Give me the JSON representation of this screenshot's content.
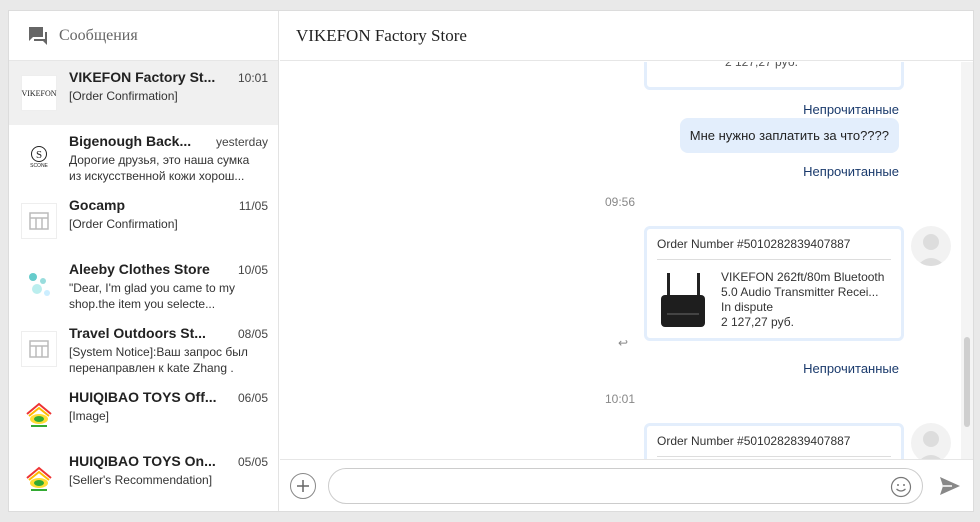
{
  "sidebar": {
    "title": "Сообщения",
    "conversations": [
      {
        "name": "VIKEFON Factory St...",
        "time": "10:01",
        "preview": "[Order Confirmation]",
        "logo": "VIKEFON"
      },
      {
        "name": "Bigenough Back...",
        "time": "yesterday",
        "preview": "Дорогие друзья, это наша сумка из искусственной кожи хорош...",
        "logo": "SCONE"
      },
      {
        "name": "Gocamp",
        "time": "11/05",
        "preview": "[Order Confirmation]"
      },
      {
        "name": "Aleeby Clothes Store",
        "time": "10/05",
        "preview": "\"Dear, I'm glad you came to my shop.the item you selecte..."
      },
      {
        "name": "Travel Outdoors St...",
        "time": "08/05",
        "preview": "[System Notice]:Ваш запрос был перенаправлен к kate Zhang ."
      },
      {
        "name": "HUIQIBAO TOYS Off...",
        "time": "06/05",
        "preview": "[Image]"
      },
      {
        "name": "HUIQIBAO TOYS On...",
        "time": "05/05",
        "preview": "[Seller's Recommendation]"
      }
    ]
  },
  "chat": {
    "title": "VIKEFON Factory Store",
    "top_price": "2 127,27 руб.",
    "unread_label": "Непрочитанные",
    "message_text": "Мне нужно заплатить за что????",
    "time_1": "09:56",
    "time_2": "10:01",
    "order_label": "Order Number #5010282839407887",
    "product_title": "VIKEFON 262ft/80m Bluetooth 5.0 Audio Transmitter Recei...",
    "product_status": "In dispute",
    "product_price": "2 127,27 руб."
  },
  "composer": {
    "placeholder": ""
  },
  "colors": {
    "bubble": "#e3eefc",
    "link": "#1a3a6c",
    "active_item": "#f0f0f0"
  }
}
